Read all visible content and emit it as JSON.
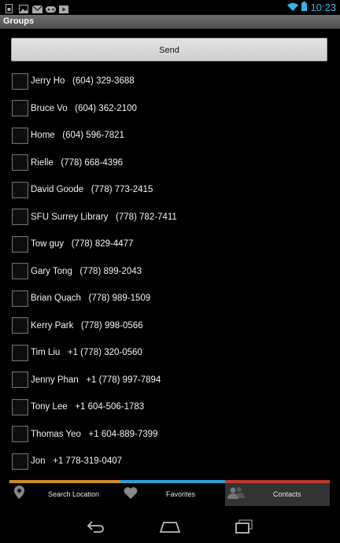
{
  "status_bar": {
    "time": "10:23",
    "left_icons": [
      "sim-icon",
      "image-icon",
      "mail-icon",
      "gamepad-icon",
      "play-icon"
    ],
    "right_icons": [
      "wifi-icon",
      "battery-icon"
    ],
    "accent": "#33b5e5"
  },
  "action_bar": {
    "title": "Groups"
  },
  "send_button": {
    "label": "Send"
  },
  "contacts": [
    {
      "label": "Jerry Ho   (604) 329-3688",
      "checked": false
    },
    {
      "label": "Bruce Vo   (604) 362-2100",
      "checked": false
    },
    {
      "label": "Home   (604) 596-7821",
      "checked": false
    },
    {
      "label": "Rielle   (778) 668-4396",
      "checked": false
    },
    {
      "label": "David Goode   (778) 773-2415",
      "checked": false
    },
    {
      "label": "SFU Surrey Library   (778) 782-7411",
      "checked": false
    },
    {
      "label": "Tow guy   (778) 829-4477",
      "checked": false
    },
    {
      "label": "Gary Tong   (778) 899-2043",
      "checked": false
    },
    {
      "label": "Brian Quach   (778) 989-1509",
      "checked": false
    },
    {
      "label": "Kerry Park   (778) 998-0566",
      "checked": false
    },
    {
      "label": "Tim Liu   +1 (778) 320-0560",
      "checked": false
    },
    {
      "label": "Jenny Phan   +1 (778) 997-7894",
      "checked": false
    },
    {
      "label": "Tony Lee   +1 604-506-1783",
      "checked": false
    },
    {
      "label": "Thomas Yeo   +1 604-889-7399",
      "checked": false
    },
    {
      "label": "Jon   +1 778-319-0407",
      "checked": false
    }
  ],
  "tabs": [
    {
      "label": "Search Location",
      "icon": "location-pin-icon",
      "color": "#d08a2c",
      "selected": false
    },
    {
      "label": "Favorites",
      "icon": "heart-icon",
      "color": "#2aa0d8",
      "selected": false
    },
    {
      "label": "Contacts",
      "icon": "contacts-icon",
      "color": "#c0392b",
      "selected": true
    }
  ],
  "nav_bar": {
    "icons": [
      "back-icon",
      "home-icon",
      "recent-apps-icon"
    ]
  }
}
